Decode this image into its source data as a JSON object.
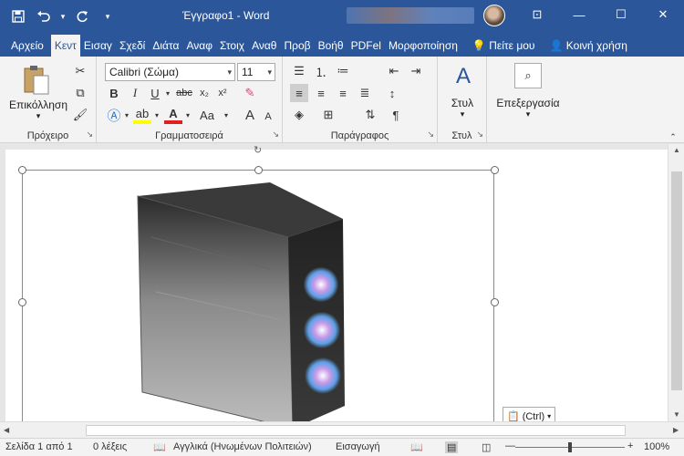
{
  "window": {
    "title": "Έγγραφο1  -  Word",
    "controls": {
      "minimize": "—",
      "restore": "☐",
      "close": "✕",
      "ribbon_display": "⊡"
    }
  },
  "qat": {
    "save": "💾",
    "undo": "↶",
    "undo_dd": "▾",
    "redo": "↻",
    "customize": "▾"
  },
  "tabs": [
    "Αρχείο",
    "Κεντ",
    "Εισαγ",
    "Σχεδί",
    "Διάτα",
    "Αναφ",
    "Στοιχ",
    "Αναθ",
    "Προβ",
    "Βοήθ",
    "PDFel",
    "Μορφοποίηση"
  ],
  "tabs_right": {
    "tell_me": "Πείτε μου",
    "share": "Κοινή χρήση"
  },
  "ribbon": {
    "clipboard": {
      "label": "Πρόχειρο",
      "paste": "Επικόλληση",
      "paste_dd": "▾"
    },
    "font": {
      "label": "Γραμματοσειρά",
      "font_name": "Calibri (Σώμα)",
      "font_size": "11",
      "bold": "B",
      "italic": "I",
      "underline": "U",
      "strike": "abc",
      "sub": "x₂",
      "sup": "x²",
      "font_color": "A",
      "case": "Aa",
      "grow": "A",
      "shrink": "A"
    },
    "paragraph": {
      "label": "Παράγραφος"
    },
    "styles": {
      "label": "Στυλ",
      "button": "Στυλ"
    },
    "editing": {
      "button": "Επεξεργασία"
    }
  },
  "paste_options": {
    "label": "(Ctrl)"
  },
  "status": {
    "page": "Σελίδα 1 από 1",
    "words": "0 λέξεις",
    "language": "Αγγλικά (Ηνωμένων Πολιτειών)",
    "mode": "Εισαγωγή",
    "zoom": "100%",
    "zoom_minus": "—",
    "zoom_plus": "+"
  }
}
